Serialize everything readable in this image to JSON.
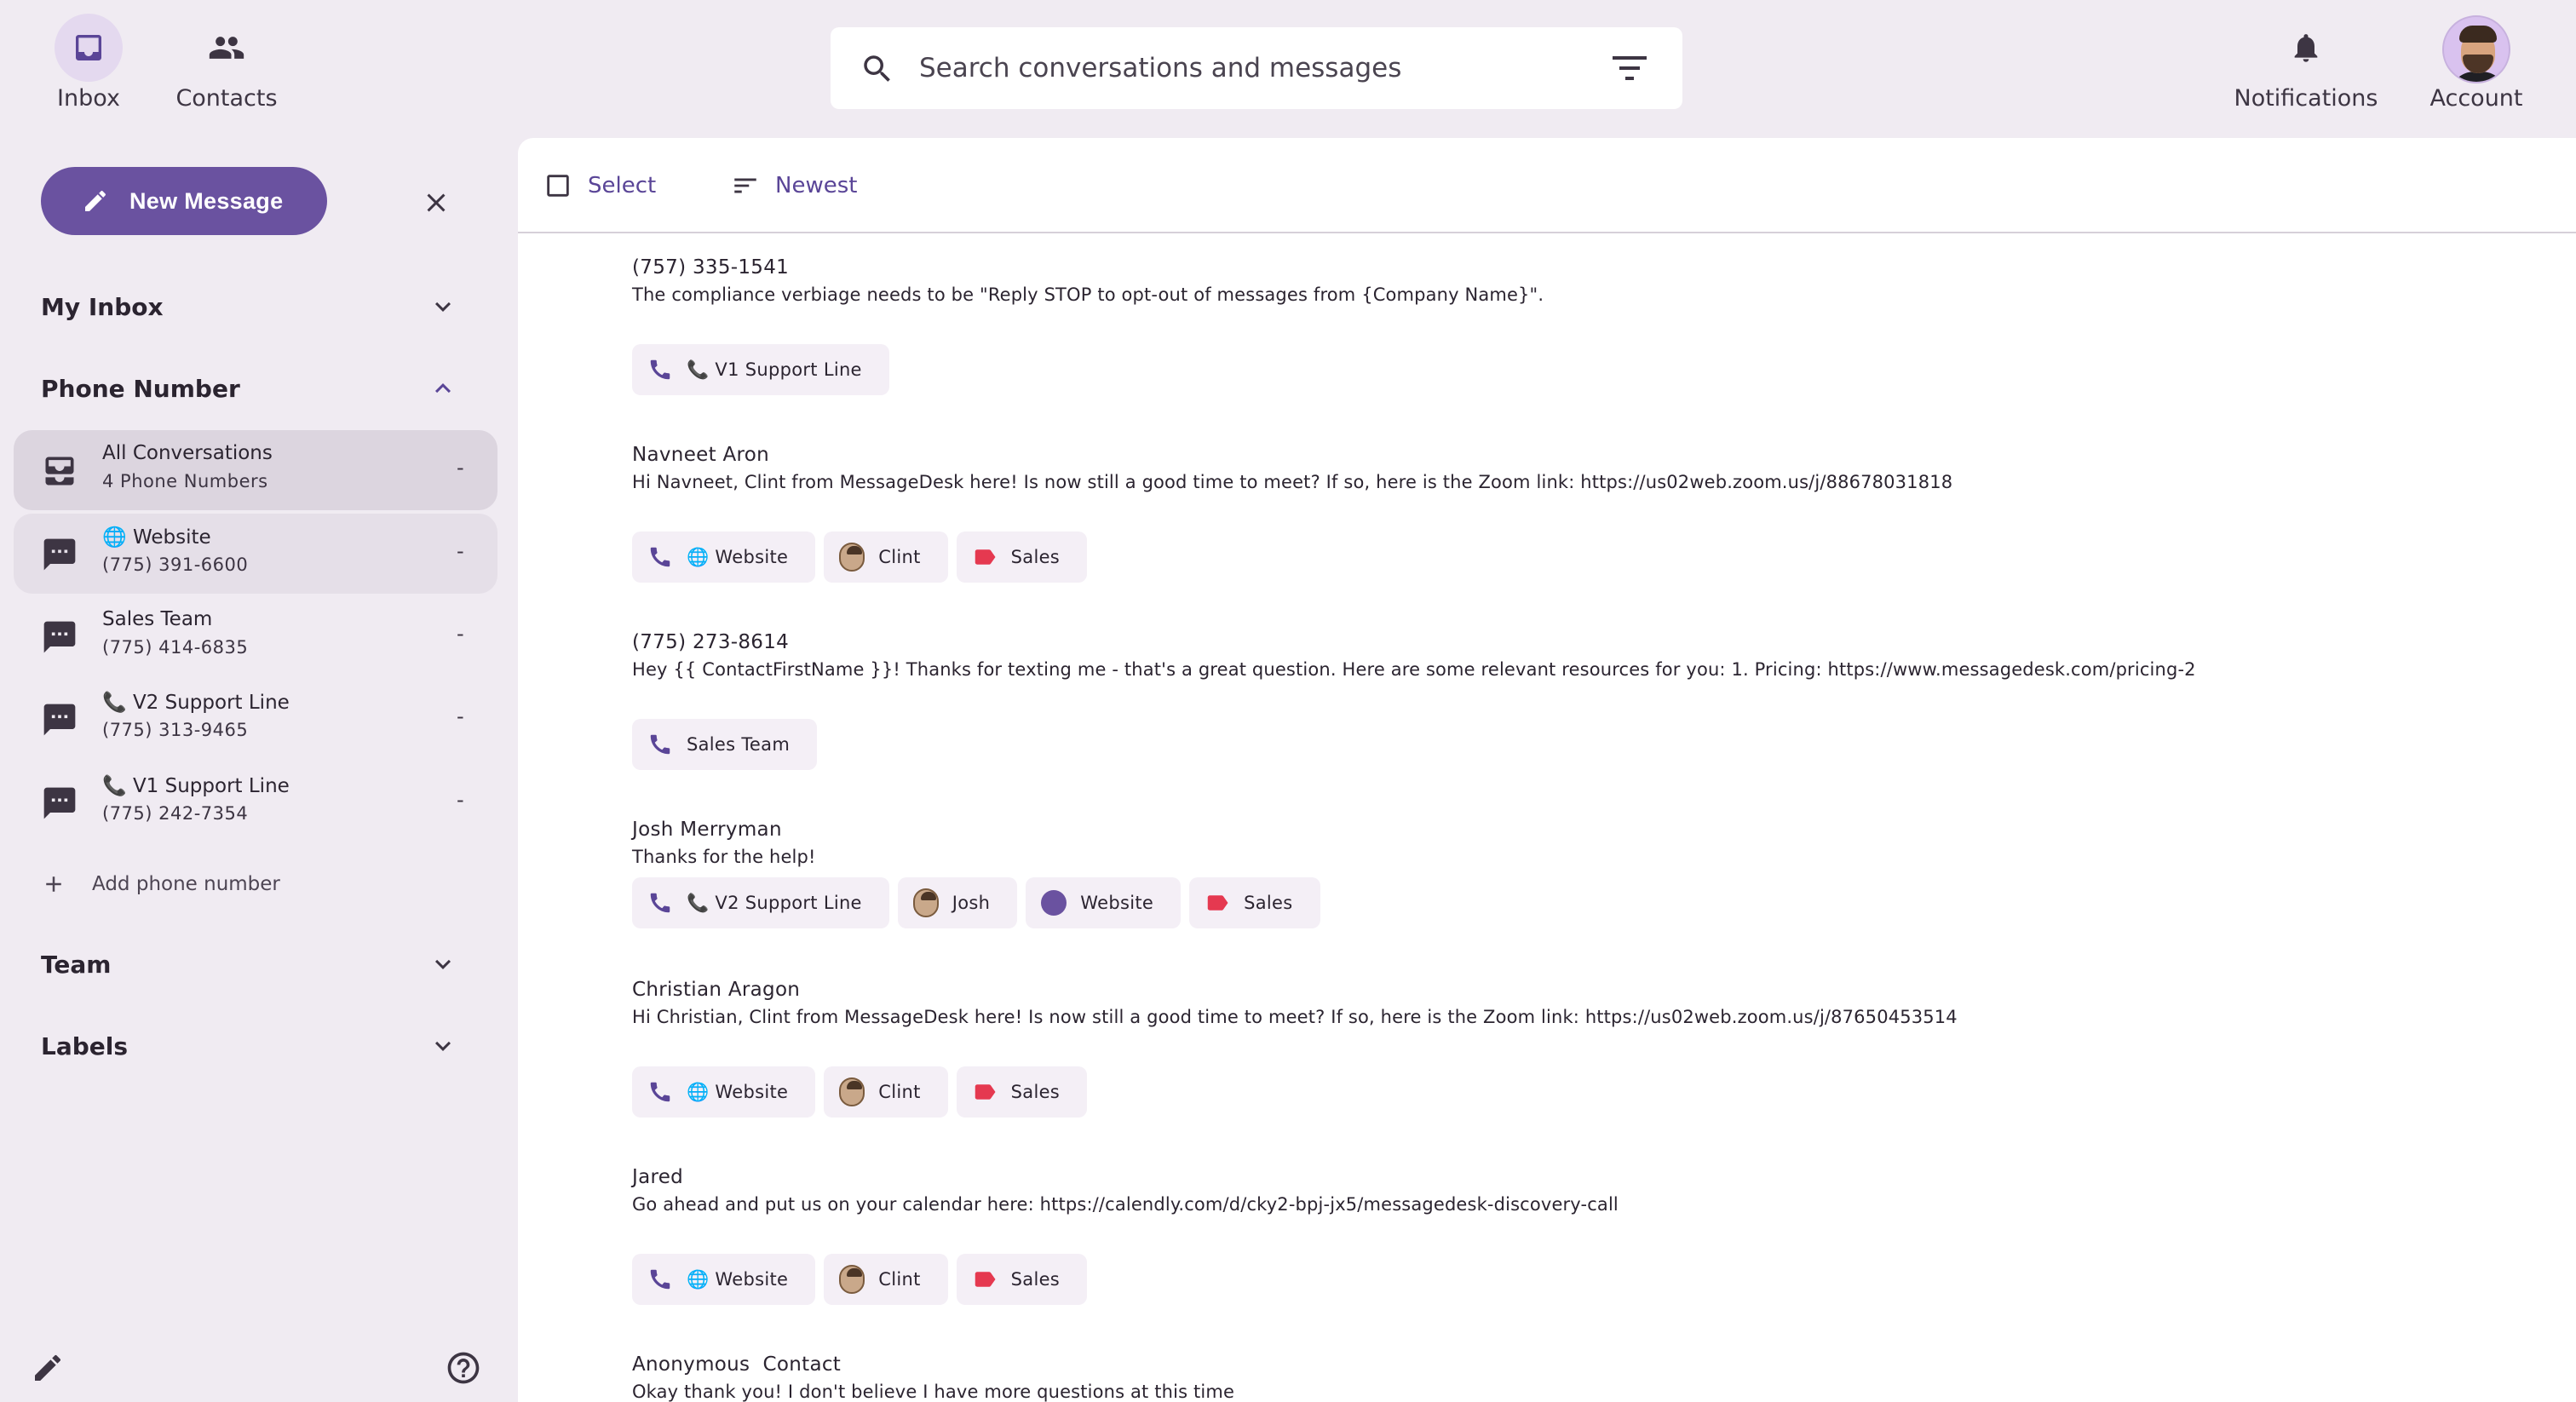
{
  "nav": {
    "inbox": "Inbox",
    "contacts": "Contacts",
    "notifications": "Notifications",
    "account": "Account"
  },
  "search": {
    "placeholder": "Search conversations and messages"
  },
  "sidebar": {
    "new_message": "New Message",
    "my_inbox": "My Inbox",
    "phone_number": "Phone Number",
    "phone_items": [
      {
        "line1": "All Conversations",
        "line2": "4 Phone Numbers",
        "count": "-"
      },
      {
        "line1": "🌐 Website",
        "line2": "(775) 391-6600",
        "count": "-"
      },
      {
        "line1": "Sales Team",
        "line2": "(775) 414-6835",
        "count": "-"
      },
      {
        "line1": "📞 V2 Support Line",
        "line2": "(775) 313-9465",
        "count": "-"
      },
      {
        "line1": "📞 V1 Support Line",
        "line2": "(775) 242-7354",
        "count": "-"
      }
    ],
    "add_phone": "Add phone number",
    "team": "Team",
    "labels": "Labels"
  },
  "toolbar": {
    "select": "Select",
    "sort": "Newest"
  },
  "conversations": [
    {
      "name": "(757) 335-1541",
      "message": "The compliance verbiage needs to be \"Reply STOP to opt-out of messages from {Company Name}\".",
      "chips": [
        "📞 V1 Support Line"
      ]
    },
    {
      "name": "Navneet Aron",
      "message": "Hi Navneet, Clint from MessageDesk here! Is now still a good time to meet? If so, here is the Zoom link: https://us02web.zoom.us/j/88678031818",
      "chips": [
        "🌐 Website",
        "Clint",
        "Sales"
      ]
    },
    {
      "name": "(775) 273-8614",
      "message": "Hey {{ ContactFirstName }}! Thanks for texting me - that's a great question. Here are some relevant resources for you: 1. Pricing: https://www.messagedesk.com/pricing-2",
      "chips": [
        "Sales Team"
      ]
    },
    {
      "name": "Josh Merryman",
      "message": "Thanks for the help!",
      "chips": [
        "📞 V2 Support Line",
        "Josh",
        "Website",
        "Sales"
      ]
    },
    {
      "name": "Christian Aragon",
      "message": "Hi Christian, Clint from MessageDesk here! Is now still a good time to meet? If so, here is the Zoom link: https://us02web.zoom.us/j/87650453514",
      "chips": [
        "🌐 Website",
        "Clint",
        "Sales"
      ]
    },
    {
      "name": "Jared",
      "message": "Go ahead and put us on your calendar here: https://calendly.com/d/cky2-bpj-jx5/messagedesk-discovery-call",
      "chips": [
        "🌐 Website",
        "Clint",
        "Sales"
      ]
    },
    {
      "name": "Anonymous  Contact",
      "message": "Okay thank you! I don't believe I have more questions at this time"
    }
  ],
  "colors": {
    "accent": "#6a52a0",
    "label_red": "#e53950",
    "sidebar_bg": "#f0ebf2"
  }
}
